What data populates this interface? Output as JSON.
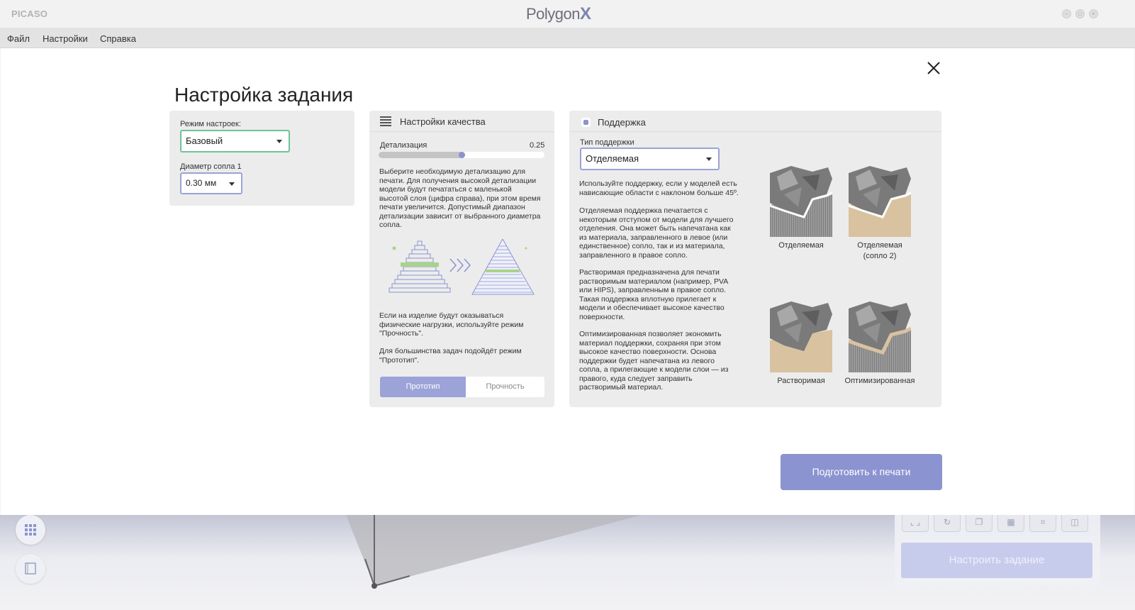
{
  "app": {
    "brand": "PICASO",
    "logo_text": "Polygon",
    "logo_mark": "X"
  },
  "menubar": {
    "items": [
      "Файл",
      "Настройки",
      "Справка"
    ]
  },
  "dialog": {
    "title": "Настройка задания",
    "prepare_button": "Подготовить к печати"
  },
  "mode_panel": {
    "mode_label": "Режим настроек:",
    "mode_value": "Базовый",
    "nozzle_label": "Диаметр сопла 1",
    "nozzle_value": "0.30 мм"
  },
  "quality_panel": {
    "title": "Настройки качества",
    "detail_label": "Детализация",
    "detail_value": "0.25",
    "slider_fraction": 0.5,
    "description": "Выберите необходимую детализацию для\nпечати. Для получения высокой детализации\nмодели будут печататься с маленькой\nвысотой слоя (цифра справа), при этом время\nпечати увеличится. Допустимый диапазон\nдетализации зависит от выбранного диаметра\nсопла.",
    "strength_note": "Если на изделие будут оказываться\nфизические нагрузки, используйте режим\n\"Прочность\".",
    "prototype_note": "Для большинства задач подойдёт режим\n\"Прототип\".",
    "modes": [
      "Прототип",
      "Прочность"
    ],
    "active_mode": "Прототип"
  },
  "support_panel": {
    "title": "Поддержка",
    "type_label": "Тип поддержки",
    "type_value": "Отделяемая",
    "text_1": "Используйте поддержку, если у моделей есть\nнависающие области с наклоном больше 45º.",
    "text_2": "Отделяемая поддержка печатается с\nнекоторым отступом от модели для лучшего\nотделения. Она может быть напечатана как\nиз материала, заправленного в левое (или\nединственное) сопло, так и из материала,\nзаправленного в правое сопло.",
    "text_3": "Растворимая предназначена для печати\nрастворимым материалом (например, PVA\nили HIPS), заправленным в правое сопло.\nТакая поддержка вплотную прилегает к\nмодели и обеспечивает высокое качество\nповерхности.",
    "text_4": "Оптимизированная позволяет экономить\nматериал поддержки, сохраняя при этом\nвысокое качество поверхности. Основа\nподдержки будет напечатана из левого\nсопла, а прилегающие к модели слои — из\nправого, куда следует заправить\nрастворимый материал.",
    "options": [
      {
        "label": "Отделяемая"
      },
      {
        "label": "Отделяемая\n(сопло 2)"
      },
      {
        "label": "Растворимая"
      },
      {
        "label": "Оптимизированная"
      }
    ]
  },
  "background": {
    "setup_button": "Настроить задание"
  },
  "colors": {
    "accent": "#8b93d0",
    "active_select": "#6cc49a",
    "green_layer": "#a8d38a",
    "support_tan": "#d9c2a0",
    "support_grey": "#8a8a8a"
  }
}
